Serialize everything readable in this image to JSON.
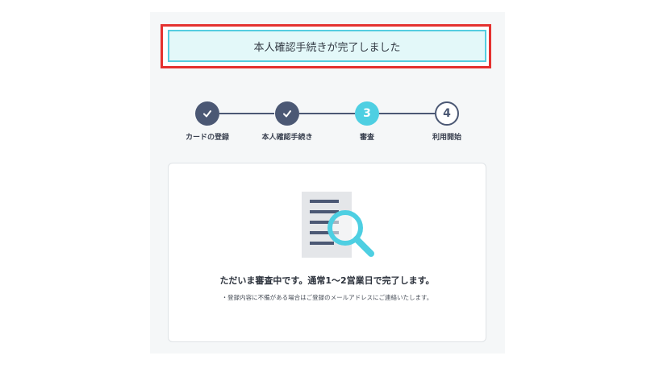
{
  "banner": {
    "message": "本人確認手続きが完了しました"
  },
  "stepper": {
    "steps": [
      {
        "label": "カードの登録",
        "state": "done",
        "number": ""
      },
      {
        "label": "本人確認手続き",
        "state": "done",
        "number": ""
      },
      {
        "label": "審査",
        "state": "current",
        "number": "3"
      },
      {
        "label": "利用開始",
        "state": "future",
        "number": "4"
      }
    ]
  },
  "status_card": {
    "title": "ただいま審査中です。通常1〜2営業日で完了します。",
    "note": "・登録内容に不備がある場合はご登録のメールアドレスにご連絡いたします。",
    "icon": "document-magnifier-icon"
  },
  "colors": {
    "highlight_border": "#e4312f",
    "banner_border": "#55cde0",
    "banner_bg": "#e3f8f9",
    "step_done": "#4b5874",
    "step_current": "#4ecfe2"
  }
}
